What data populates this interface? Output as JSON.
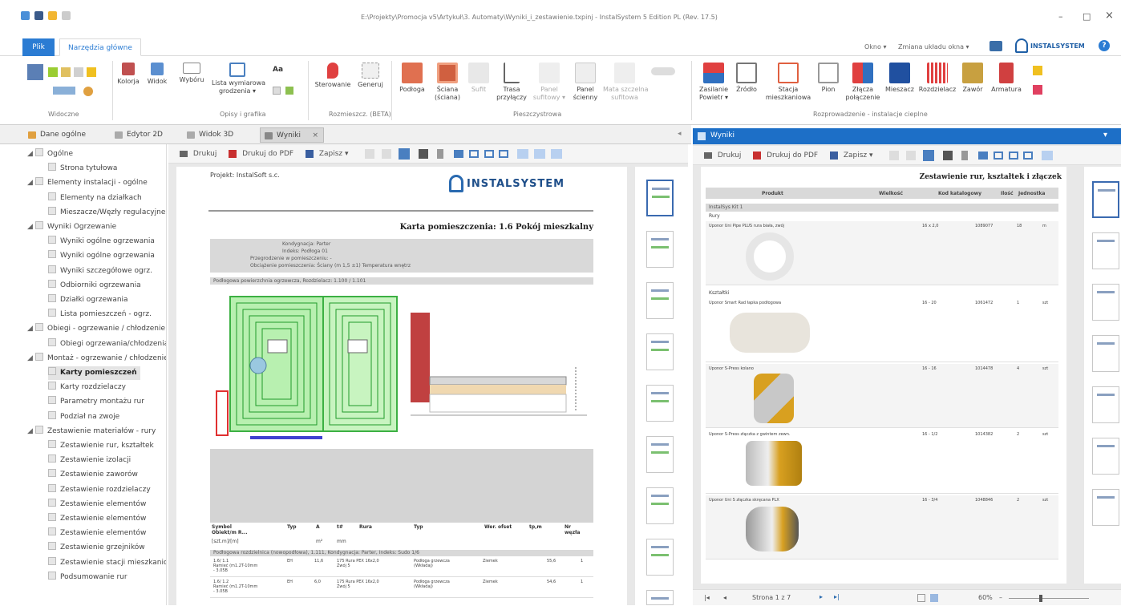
{
  "window": {
    "title": "E:\\Projekty\\Promocja v5\\Artykuł\\3. Automaty\\Wyniki_i_zestawienie.txpinj - InstalSystem 5 Edition PL (Rev. 17.5)",
    "min": "–",
    "max": "□",
    "close": "×"
  },
  "ribbon_tabs": [
    {
      "label": "Plik"
    },
    {
      "label": "Narzędzia główne"
    }
  ],
  "ribbon_right": {
    "options": "Okno ▾",
    "style_label": "Zmiana układu okna ▾",
    "logo": "INSTALSYSTEM",
    "help": "?"
  },
  "ribbon_groups": [
    {
      "label": "Widoczne"
    },
    {
      "label": "Opisy i grafika"
    },
    {
      "label": "Rozmieszcz. (BETA)"
    },
    {
      "label": "Pieszczystrowa"
    },
    {
      "label": "Rozprowadzenie - instalacje cieplne"
    }
  ],
  "ribbon_buttons": {
    "kolorja": "Kolorja",
    "widok": "Widok",
    "wyboru": "Wybóru",
    "lista": "Lista wymiarowa\ngrodzenia ▾",
    "kierowanie": "Sterowanie",
    "generuj": "Generuj",
    "podloga": "Podłoga",
    "sciana": "Ściana\n(ściana)",
    "sufit": "Sufit",
    "trasa": "Trasa\nprzyłączy",
    "panel_sufitowy": "Panel\nsufitowy ▾",
    "panel_scienny": "Panel\nścienny",
    "mata": "Mata szczelna\nsufitowa",
    "zasilanie": "Zasilanie\nPowietr ▾",
    "zrodlo": "Źródło",
    "stacja": "Stacja\nmieszkaniowa",
    "pion": "Pion",
    "zlacza": "Złącza\npołączenie",
    "mieszacz": "Mieszacz",
    "rozdzielacz": "Rozdzielacz",
    "zawor": "Zawór",
    "armatura": "Armatura"
  },
  "doc_tabs": [
    {
      "label": "Dane ogólne"
    },
    {
      "label": "Edytor 2D"
    },
    {
      "label": "Widok 3D"
    },
    {
      "label": "Wyniki"
    }
  ],
  "right_header": {
    "label": "Wyniki"
  },
  "tree": [
    {
      "label": "Ogólne",
      "level": 0,
      "exp": "◢"
    },
    {
      "label": "Strona tytułowa",
      "level": 1
    },
    {
      "label": "Elementy instalacji - ogólne",
      "level": 0,
      "exp": "◢"
    },
    {
      "label": "Elementy na działkach",
      "level": 1
    },
    {
      "label": "Mieszacze/Węzły regulacyjne",
      "level": 1
    },
    {
      "label": "Wyniki Ogrzewanie",
      "level": 0,
      "exp": "◢"
    },
    {
      "label": "Wyniki ogólne ogrzewania",
      "level": 1
    },
    {
      "label": "Wyniki ogólne ogrzewania",
      "level": 1
    },
    {
      "label": "Wyniki szczegółowe ogrz.",
      "level": 1
    },
    {
      "label": "Odbiorniki ogrzewania",
      "level": 1
    },
    {
      "label": "Działki ogrzewania",
      "level": 1
    },
    {
      "label": "Lista pomieszczeń - ogrz.",
      "level": 1
    },
    {
      "label": "Obiegi - ogrzewanie / chłodzenie",
      "level": 0,
      "exp": "◢"
    },
    {
      "label": "Obiegi ogrzewania/chłodzenia",
      "level": 1
    },
    {
      "label": "Montaż - ogrzewanie / chłodzenie",
      "level": 0,
      "exp": "◢"
    },
    {
      "label": "Karty pomieszczeń",
      "level": 1,
      "selected": true
    },
    {
      "label": "Karty rozdzielaczy",
      "level": 1
    },
    {
      "label": "Parametry montażu rur",
      "level": 1
    },
    {
      "label": "Podział na zwoje",
      "level": 1
    },
    {
      "label": "Zestawienie materiałów - rury",
      "level": 0,
      "exp": "◢"
    },
    {
      "label": "Zestawienie rur, kształtek",
      "level": 1
    },
    {
      "label": "Zestawienie izolacji",
      "level": 1
    },
    {
      "label": "Zestawienie zaworów",
      "level": 1
    },
    {
      "label": "Zestawienie rozdzielaczy",
      "level": 1
    },
    {
      "label": "Zestawienie elementów",
      "level": 1
    },
    {
      "label": "Zestawienie elementów",
      "level": 1
    },
    {
      "label": "Zestawienie elementów",
      "level": 1
    },
    {
      "label": "Zestawienie grzejników",
      "level": 1
    },
    {
      "label": "Zestawienie stacji mieszkaniowych",
      "level": 1
    },
    {
      "label": "Podsumowanie rur",
      "level": 1
    }
  ],
  "preview_toolbar": {
    "print": "Drukuj",
    "print_pdf": "Drukuj do PDF",
    "save": "Zapisz ▾"
  },
  "left_doc": {
    "project": "Projekt: InstalSoft s.c.",
    "logo": "INSTALSYSTEM",
    "card_title": "Karta pomieszczenia: 1.6 Pokój mieszkalny",
    "header_lines": [
      "Kondygnacja: Parter",
      "Indeks: Podłoga 01",
      "Przegrodzenie w pomieszczeniu: -",
      "Obciążenie pomieszczenia: Ściany (m 1,5 ±1) Temperatura wnętrz"
    ],
    "section1": "Podłogowa powierzchnia ogrzewcza, Rozdzielacz: 1.100 / 1.101",
    "table_header": [
      "Symbol\nObiekt/m R...",
      "Typ",
      "A",
      "t#",
      "Rura",
      "Typ",
      "Wer. ofset",
      "tp,m",
      "Nr\nwęzła"
    ],
    "table_units": [
      "[szt.m]/[m]",
      "",
      "m²",
      "mm",
      "",
      "",
      "",
      "",
      ""
    ],
    "footer_section": "Podłogowa rozdzielnica (nowopodłowa), 1.111, Kondygnacja: Parter, Indeks: Sudo 1/6",
    "rows": [
      [
        "1.6/ 1.1\nRamieć (m1.2T-10mm\n- 3.05B",
        "EH",
        "11,6",
        "175 Rura PEX 16x2,0\nZwój 5",
        "Podłoga grzewcza\n(Wkładaj)",
        "Ziemek",
        "55,6",
        "1"
      ],
      [
        "1.6/ 1.2\nRamieć (m1.2T-10mm\n- 3.05B",
        "EH",
        "6,0",
        "175 Rura PEX 16x2,0\nZwój 5",
        "Podłoga grzewcza\n(Wkładaj)",
        "Ziemek",
        "54,6",
        "1"
      ]
    ]
  },
  "right_doc": {
    "title": "Zestawienie rur, kształtek i złączek",
    "columns": [
      "Produkt",
      "Wielkość",
      "Kod katalogowy",
      "Ilość",
      "Jednostka"
    ],
    "section_main": "InstalSys Kit 1",
    "groups": [
      {
        "group": "Rury",
        "items": [
          {
            "name": "Uponor Uni Pipe PLUS rura biała, zwój",
            "size": "16 x 2,0",
            "code": "1089077",
            "qty": "18",
            "unit": "m"
          }
        ]
      },
      {
        "group": "Kształtki",
        "items": [
          {
            "name": "Uponor Smart Rad łapka podłogowa",
            "size": "16 - 20",
            "code": "1061472",
            "qty": "1",
            "unit": "szt"
          },
          {
            "name": "Uponor S-Press kolano",
            "size": "16 - 16",
            "code": "1014478",
            "qty": "4",
            "unit": "szt"
          },
          {
            "name": "Uponor S-Press złączka z gwintem zewn.",
            "size": "16 - 1/2",
            "code": "1014382",
            "qty": "2",
            "unit": "szt"
          },
          {
            "name": "Uponor Uni S złączka skręcana PLX",
            "size": "16 - 3/4",
            "code": "1048846",
            "qty": "2",
            "unit": "szt"
          }
        ]
      }
    ]
  },
  "right_status": {
    "page": "Strona 1 z 7",
    "zoom": "60%"
  }
}
